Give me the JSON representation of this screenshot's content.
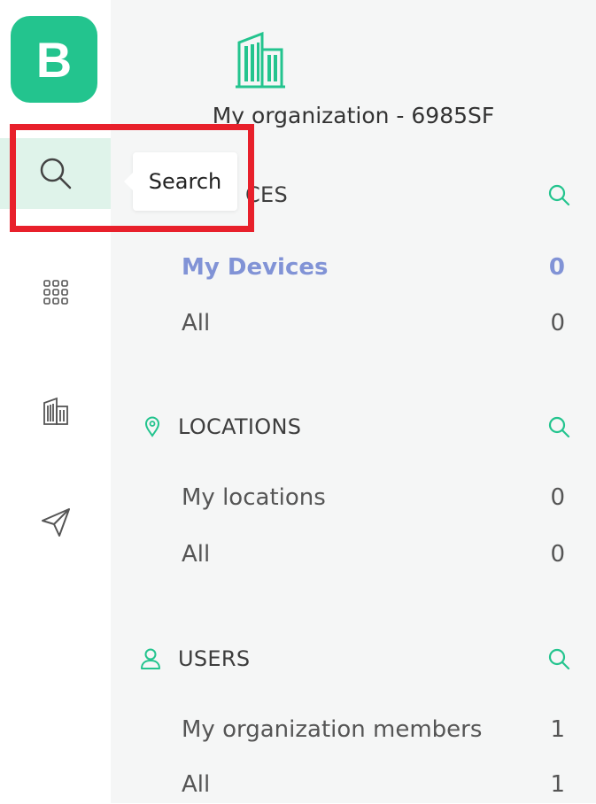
{
  "app": {
    "logo_letter": "B",
    "brand_color": "#23c48e"
  },
  "rail": {
    "items": [
      {
        "icon": "search-icon",
        "active": true
      },
      {
        "icon": "grid-icon",
        "active": false
      },
      {
        "icon": "building-icon",
        "active": false
      },
      {
        "icon": "send-icon",
        "active": false
      }
    ]
  },
  "tooltip": {
    "text": "Search"
  },
  "org": {
    "name": "My organization - 6985SF",
    "icon": "building-icon"
  },
  "sections": {
    "devices": {
      "title": "CES",
      "rows": [
        {
          "label": "My Devices",
          "count": "0",
          "active": true
        },
        {
          "label": "All",
          "count": "0",
          "active": false
        }
      ]
    },
    "locations": {
      "title": "LOCATIONS",
      "icon": "location-pin-icon",
      "rows": [
        {
          "label": "My locations",
          "count": "0"
        },
        {
          "label": "All",
          "count": "0"
        }
      ]
    },
    "users": {
      "title": "USERS",
      "icon": "user-icon",
      "rows": [
        {
          "label": "My organization members",
          "count": "1"
        },
        {
          "label": "All",
          "count": "1"
        }
      ]
    }
  },
  "colors": {
    "accent_green": "#23c48e",
    "active_blue": "#8193d6",
    "highlight_red": "#e8202b"
  }
}
